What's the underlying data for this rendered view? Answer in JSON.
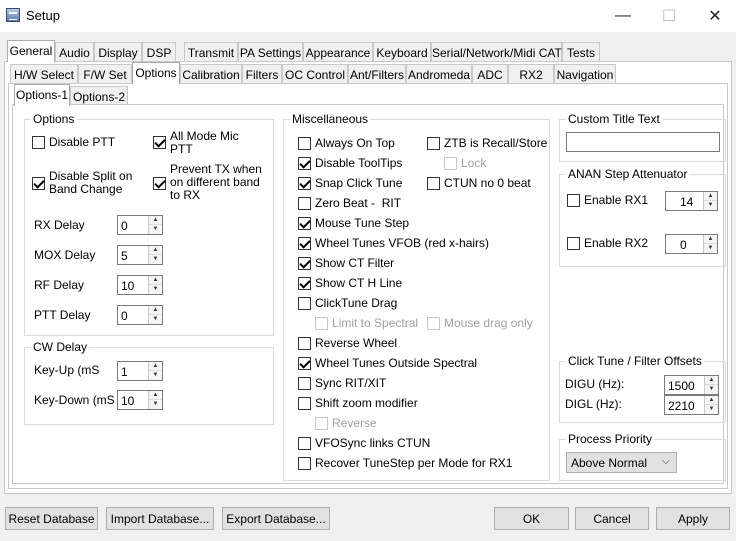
{
  "window": {
    "title": "Setup",
    "minimize": "—",
    "maximize": "☐",
    "close": "✕"
  },
  "tabs_main": [
    "General",
    "Audio",
    "Display",
    "DSP",
    "Transmit",
    "PA Settings",
    "Appearance",
    "Keyboard",
    "Serial/Network/Midi CAT",
    "Tests"
  ],
  "tabs_sub": [
    "H/W Select",
    "F/W Set",
    "Options",
    "Calibration",
    "Filters",
    "OC Control",
    "Ant/Filters",
    "Andromeda",
    "ADC",
    "RX2",
    "Navigation"
  ],
  "tabs_inner": [
    "Options-1",
    "Options-2"
  ],
  "options_group": {
    "title": "Options",
    "disable_ptt": "Disable PTT",
    "all_mode_mic_ptt": "All Mode Mic PTT",
    "disable_split": "Disable Split on Band Change",
    "prevent_tx": "Prevent TX when on different band to RX",
    "rx_delay": {
      "label": "RX Delay",
      "value": "0"
    },
    "mox_delay": {
      "label": "MOX Delay",
      "value": "5"
    },
    "rf_delay": {
      "label": "RF Delay",
      "value": "10"
    },
    "ptt_delay": {
      "label": "PTT Delay",
      "value": "0"
    }
  },
  "cw_delay": {
    "title": "CW Delay",
    "key_up": {
      "label": "Key-Up (mS",
      "value": "1"
    },
    "key_down": {
      "label": "Key-Down (mS",
      "value": "10"
    }
  },
  "misc": {
    "title": "Miscellaneous",
    "always_on_top": "Always On Top",
    "ztb": "ZTB is Recall/Store",
    "lock": "Lock",
    "disable_tooltips": "Disable ToolTips",
    "snap_click": "Snap Click Tune",
    "ctun_no0": "CTUN no 0 beat",
    "zero_beat": "Zero Beat -  RIT",
    "mouse_tune_step": "Mouse Tune Step",
    "wheel_tunes_vfob": "Wheel Tunes VFOB (red x-hairs)",
    "show_ct_filter": "Show CT Filter",
    "show_ct_hline": "Show CT H Line",
    "clicktune_drag": "ClickTune Drag",
    "limit_spectral": "Limit to Spectral",
    "mouse_drag_only": "Mouse drag only",
    "reverse_wheel": "Reverse Wheel",
    "wheel_outside": "Wheel Tunes Outside Spectral",
    "sync_rit": "Sync RIT/XIT",
    "shift_zoom": "Shift zoom modifier",
    "reverse": "Reverse",
    "vfosync": "VFOSync links CTUN",
    "recover_tunestep": "Recover TuneStep per Mode for RX1"
  },
  "custom_title": {
    "title": "Custom Title Text",
    "value": ""
  },
  "anan_step": {
    "title": "ANAN Step Attenuator",
    "rx1": {
      "label": "Enable RX1",
      "value": "14"
    },
    "rx2": {
      "label": "Enable RX2",
      "value": "0"
    }
  },
  "click_tune": {
    "title": "Click Tune / Filter Offsets",
    "digu": {
      "label": "DIGU (Hz):",
      "value": "1500"
    },
    "digl": {
      "label": "DIGL (Hz):",
      "value": "2210"
    }
  },
  "process_priority": {
    "title": "Process Priority",
    "value": "Above Normal"
  },
  "footer": {
    "reset_db": "Reset Database",
    "import_db": "Import Database...",
    "export_db": "Export Database...",
    "ok": "OK",
    "cancel": "Cancel",
    "apply": "Apply"
  }
}
